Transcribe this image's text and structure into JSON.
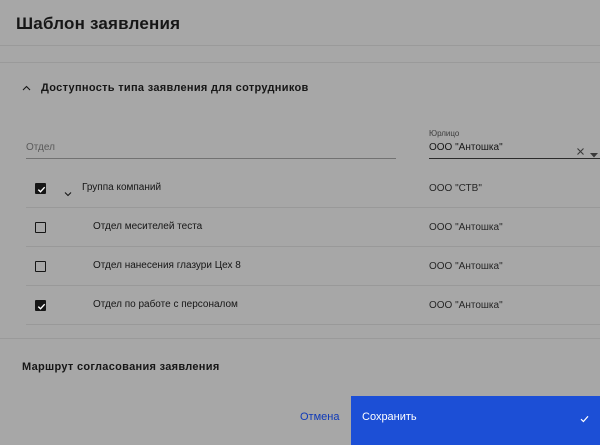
{
  "modal": {
    "title": "Шаблон заявления"
  },
  "availability": {
    "section_title": "Доступность типа заявления для сотрудников",
    "department_placeholder": "Отдел",
    "legal_entity_label": "Юрлицо",
    "legal_entity_value": "ООО \"Антошка\"",
    "rows": [
      {
        "name": "Группа компаний",
        "org": "ООО \"СТВ\"",
        "checked": true,
        "expandable": true
      },
      {
        "name": "Отдел месителей теста",
        "org": "ООО \"Антошка\"",
        "checked": false,
        "expandable": false
      },
      {
        "name": "Отдел нанесения глазури Цех 8",
        "org": "ООО \"Антошка\"",
        "checked": false,
        "expandable": false
      },
      {
        "name": "Отдел по работе с персоналом",
        "org": "ООО \"Антошка\"",
        "checked": true,
        "expandable": false
      }
    ]
  },
  "route": {
    "section_title": "Маршрут согласования заявления"
  },
  "footer": {
    "cancel_label": "Отмена",
    "save_label": "Сохранить"
  },
  "colors": {
    "overlay": "#a7a7a7",
    "primary": "#1c4fd6",
    "link": "#0f3ab8"
  },
  "icons": {
    "section_toggle": "chevron-up-icon",
    "row_expand": "chevron-down-icon",
    "clear": "close-icon",
    "dropdown": "caret-down-icon",
    "save": "checkmark-icon"
  }
}
